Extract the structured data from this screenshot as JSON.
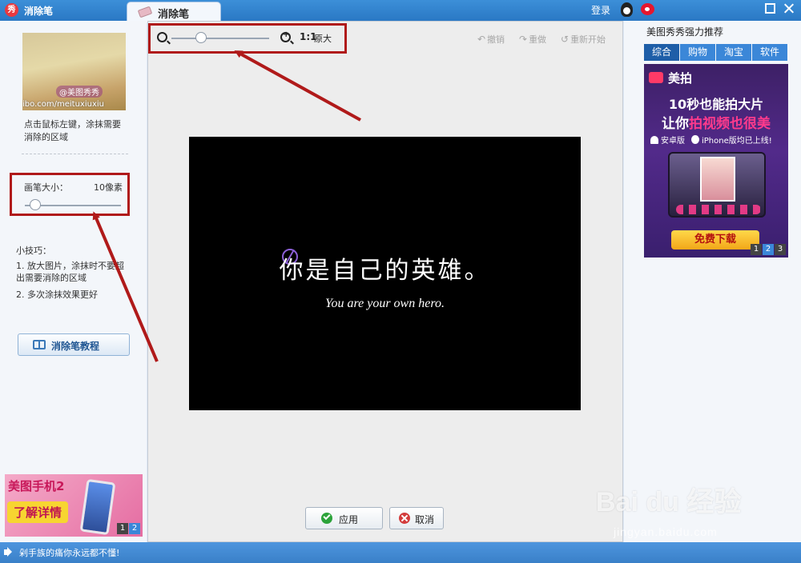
{
  "titlebar": {
    "app_title": "消除笔",
    "logo_char": "秀",
    "tab_label": "消除笔",
    "login": "登录"
  },
  "left": {
    "thumb_watermark": "ibo.com/meituxiuxiu",
    "thumb_tag": "@美图秀秀",
    "hint": "点击鼠标左键，涂抹需要消除的区域",
    "brush_label": "画笔大小：",
    "brush_value": "10像素",
    "tips_title": "小技巧：",
    "tip1": "1. 放大图片，涂抹时不要超出需要消除的区域",
    "tip2": "2. 多次涂抹效果更好",
    "tutorial_button": "消除笔教程",
    "ad_title": "美图手机2",
    "ad_button": "了解详情",
    "ad_pages": [
      "1",
      "2"
    ]
  },
  "center": {
    "zoom_ratio": "1:1",
    "zoom_original": "原大",
    "undo": "撤销",
    "redo": "重做",
    "reset": "重新开始",
    "canvas_text_cn": "你是自己的英雄。",
    "canvas_text_en": "You are your own hero.",
    "apply": "应用",
    "cancel": "取消"
  },
  "right": {
    "title": "美图秀秀强力推荐",
    "tabs": [
      "综合",
      "购物",
      "淘宝",
      "软件"
    ],
    "ad_brand": "美拍",
    "ad_line1": "10秒也能拍大片",
    "ad_line2_prefix": "让你",
    "ad_line2_highlight": "拍视频也很美",
    "ad_android": "安卓版",
    "ad_iphone": "iPhone版均已上线!",
    "ad_download": "免费下载",
    "ad_pages": [
      "1",
      "2",
      "3"
    ]
  },
  "status": {
    "text": "剁手族的痛你永远都不懂!"
  },
  "watermark": {
    "brand": "Bai du 经验",
    "url": "jingyan.baidu.com"
  },
  "colors": {
    "titlebar": "#2a78c4",
    "annotation": "#b01a1a",
    "canvas": "#000000",
    "accent": "#3b87d8"
  }
}
